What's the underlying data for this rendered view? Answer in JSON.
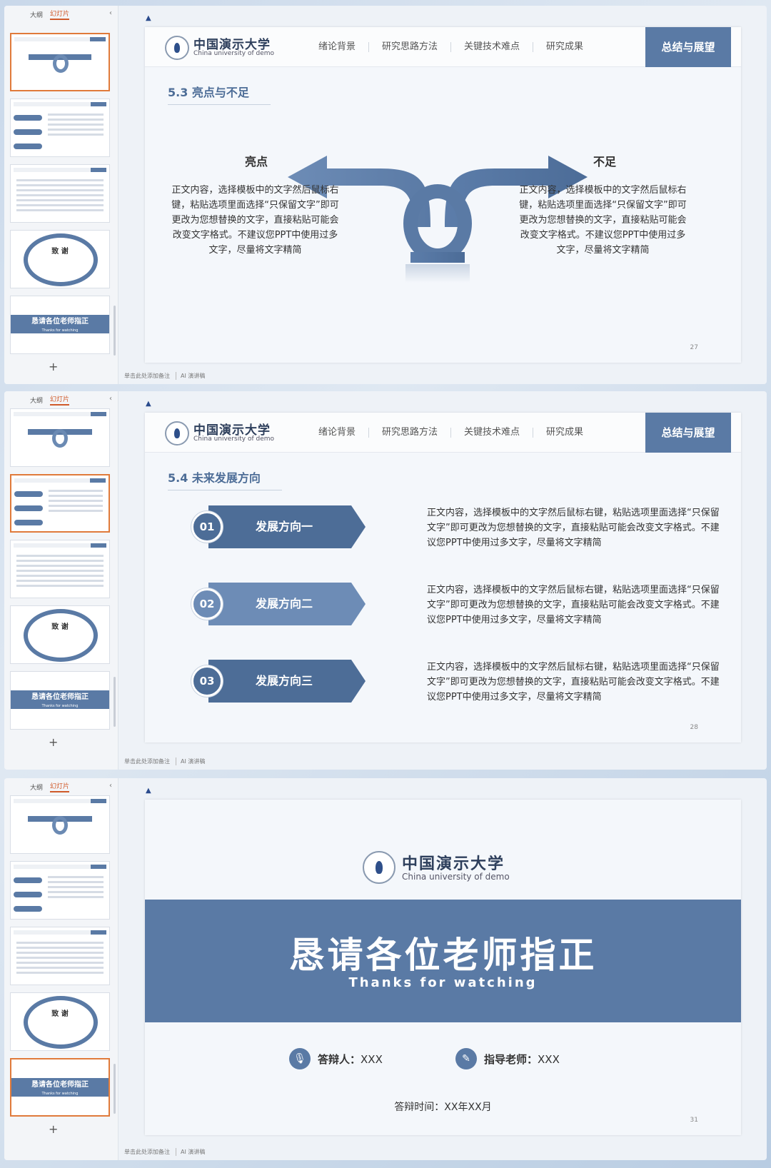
{
  "sidebar": {
    "tab_outline": "大纲",
    "tab_slides": "幻灯片",
    "collapse": "‹",
    "add": "+",
    "thumb_thanks_title": "致 谢",
    "thumb_end_title": "恳请各位老师指正",
    "thumb_end_sub": "Thanks for watching"
  },
  "footer": {
    "notes": "单击此处添加备注",
    "ai": "AI 演讲稿"
  },
  "header": {
    "logo_cn": "中国演示大学",
    "logo_en": "China university of demo",
    "nav": [
      "绪论背景",
      "研究思路方法",
      "关键技术难点",
      "研究成果"
    ],
    "nav_active": "总结与展望"
  },
  "slide27": {
    "section": "5.3 亮点与不足",
    "left_label": "亮点",
    "right_label": "不足",
    "left_text": "正文内容，选择模板中的文字然后鼠标右键，粘贴选项里面选择“只保留文字”即可更改为您想替换的文字，直接粘贴可能会改变文字格式。不建议您PPT中使用过多文字，尽量将文字精简",
    "right_text": "正文内容，选择模板中的文字然后鼠标右键，粘贴选项里面选择“只保留文字”即可更改为您想替换的文字，直接粘贴可能会改变文字格式。不建议您PPT中使用过多文字，尽量将文字精简",
    "page": "27"
  },
  "slide28": {
    "section": "5.4 未来发展方向",
    "items": [
      {
        "num": "01",
        "label": "发展方向一",
        "text": "正文内容，选择模板中的文字然后鼠标右键，粘贴选项里面选择“只保留文字”即可更改为您想替换的文字，直接粘贴可能会改变文字格式。不建议您PPT中使用过多文字，尽量将文字精简"
      },
      {
        "num": "02",
        "label": "发展方向二",
        "text": "正文内容，选择模板中的文字然后鼠标右键，粘贴选项里面选择“只保留文字”即可更改为您想替换的文字，直接粘贴可能会改变文字格式。不建议您PPT中使用过多文字，尽量将文字精简"
      },
      {
        "num": "03",
        "label": "发展方向三",
        "text": "正文内容，选择模板中的文字然后鼠标右键，粘贴选项里面选择“只保留文字”即可更改为您想替换的文字，直接粘贴可能会改变文字格式。不建议您PPT中使用过多文字，尽量将文字精简"
      }
    ],
    "page": "28"
  },
  "slide31": {
    "title": "恳请各位老师指正",
    "subtitle": "Thanks for watching",
    "defender_label": "答辩人：",
    "defender_value": "XXX",
    "advisor_label": "指导老师：",
    "advisor_value": "XXX",
    "date": "答辩时间：XX年XX月",
    "page": "31"
  },
  "colors": {
    "accent": "#5a7aa5",
    "accent_dark": "#4d6d97",
    "selection": "#e07a3a"
  }
}
